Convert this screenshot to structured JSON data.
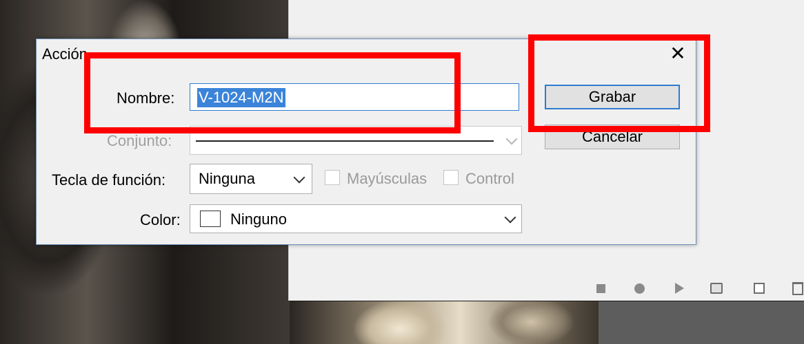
{
  "dialog": {
    "title": "Acción",
    "close_icon": "close-icon",
    "fields": {
      "nombre": {
        "label": "Nombre:",
        "value": "V-1024-M2N"
      },
      "conjunto": {
        "label": "Conjunto:"
      },
      "tecla": {
        "label": "Tecla de función:",
        "value": "Ninguna"
      },
      "mayusculas": {
        "label": "Mayúsculas",
        "checked": false
      },
      "control": {
        "label": "Control",
        "checked": false
      },
      "color": {
        "label": "Color:",
        "value": "Ninguno"
      }
    },
    "buttons": {
      "grabar": "Grabar",
      "cancelar": "Cancelar"
    }
  },
  "panel_toolbar": [
    "stop-icon",
    "record-icon",
    "play-icon",
    "folder-icon",
    "new-action-icon",
    "trash-icon"
  ],
  "annotation_color": "#ff0000"
}
